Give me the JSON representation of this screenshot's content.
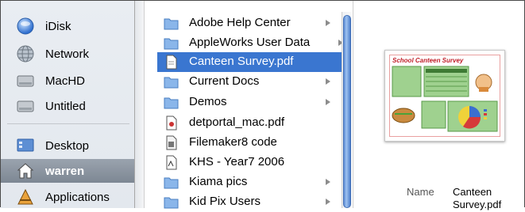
{
  "sidebar": {
    "items": [
      {
        "label": "iDisk",
        "icon": "idisk-icon"
      },
      {
        "label": "Network",
        "icon": "network-globe-icon"
      },
      {
        "label": "MacHD",
        "icon": "hard-drive-icon"
      },
      {
        "label": "Untitled",
        "icon": "hard-drive-icon"
      },
      {
        "label": "Desktop",
        "icon": "desktop-icon"
      },
      {
        "label": "warren",
        "icon": "home-icon",
        "selected": true
      },
      {
        "label": "Applications",
        "icon": "applications-icon"
      }
    ]
  },
  "files": {
    "rows": [
      {
        "label": "Adobe Help Center",
        "icon": "folder-icon",
        "has_children": true
      },
      {
        "label": "AppleWorks User Data",
        "icon": "folder-icon",
        "has_children": true
      },
      {
        "label": "Canteen Survey.pdf",
        "icon": "document-icon",
        "selected": true
      },
      {
        "label": "Current Docs",
        "icon": "folder-icon",
        "has_children": true
      },
      {
        "label": "Demos",
        "icon": "folder-icon",
        "has_children": true
      },
      {
        "label": "detportal_mac.pdf",
        "icon": "document-icon"
      },
      {
        "label": "Filemaker8 code",
        "icon": "document-icon"
      },
      {
        "label": "KHS - Year7 2006",
        "icon": "document-icon"
      },
      {
        "label": "Kiama pics",
        "icon": "folder-icon",
        "has_children": true
      },
      {
        "label": "Kid Pix Users",
        "icon": "folder-icon",
        "has_children": true
      }
    ]
  },
  "preview": {
    "thumbnail_title": "School Canteen Survey",
    "name_label": "Name",
    "name_value": "Canteen Survey.pdf",
    "colors": {
      "accent": "#c0202a",
      "panel": "#9fd18f"
    }
  },
  "colors": {
    "selection": "#3a76d0",
    "sidebar_selection": "#8a939e",
    "sidebar_bg": "#e6eaef"
  }
}
